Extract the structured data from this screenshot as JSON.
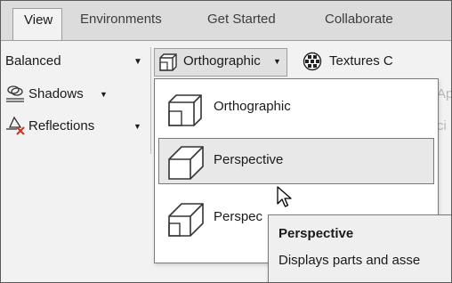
{
  "tabs": [
    {
      "label": "View"
    },
    {
      "label": "Environments"
    },
    {
      "label": "Get Started"
    },
    {
      "label": "Collaborate"
    }
  ],
  "ribbon": {
    "quality_dropdown": "Balanced",
    "projection_button": "Orthographic",
    "textures_button": "Textures C",
    "shadows_button": "Shadows",
    "reflections_button": "Reflections",
    "faded_ap": "Ap",
    "faded_ci": "ci"
  },
  "projection_menu": {
    "items": [
      {
        "label": "Orthographic"
      },
      {
        "label": "Perspective"
      },
      {
        "label": "Perspec"
      }
    ]
  },
  "tooltip": {
    "title": "Perspective",
    "body": "Displays parts and asse"
  },
  "colors": {
    "tab_bg": "#dcdcdc",
    "ribbon_bg": "#f2f2f2",
    "menu_hover": "#e8e8e8",
    "border": "#7a7a7a"
  }
}
